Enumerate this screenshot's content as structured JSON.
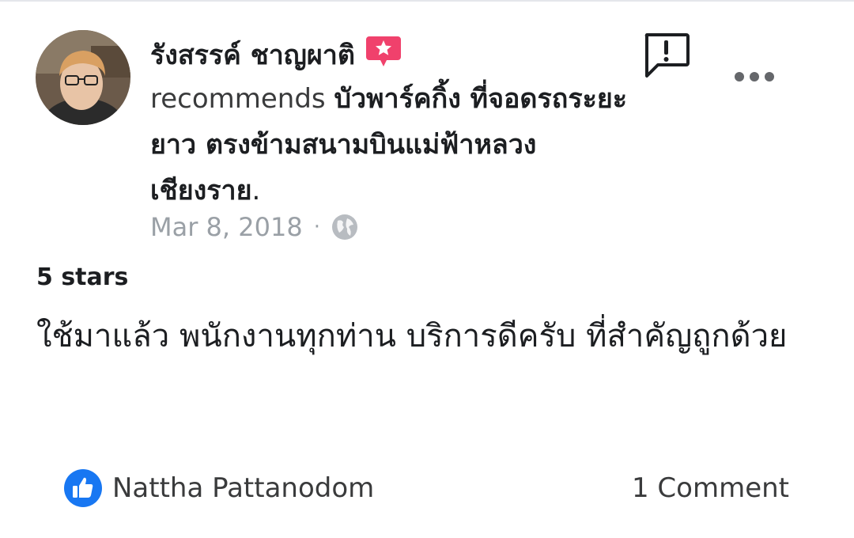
{
  "post": {
    "author": "รังสรรค์ ชาญผาติ",
    "recommend_verb": "recommends",
    "place_name": "บัวพาร์คกิ้ง ที่จอดรถระยะยาว ตรงข้ามสนามบินแม่ฟ้าหลวง เชียงราย",
    "place_suffix": ".",
    "date": "Mar 8, 2018",
    "separator": "·",
    "privacy_icon": "globe-icon",
    "badge_icon": "star-badge-icon",
    "report_icon": "report-speech-bubble-icon",
    "more_icon": "more-dots-icon"
  },
  "review": {
    "rating_label": "5 stars",
    "text": "ใช้มาแล้ว พนักงานทุกท่าน บริการดีครับ ที่สำคัญถูกด้วย"
  },
  "footer": {
    "reaction_icon": "like-icon",
    "reactor_name": "Nattha Pattanodom",
    "comment_count": "1 Comment"
  },
  "colors": {
    "badge": "#f0416c",
    "like": "#1877f2",
    "muted_text": "#9aa0a6",
    "icon_gray": "#65676b"
  }
}
